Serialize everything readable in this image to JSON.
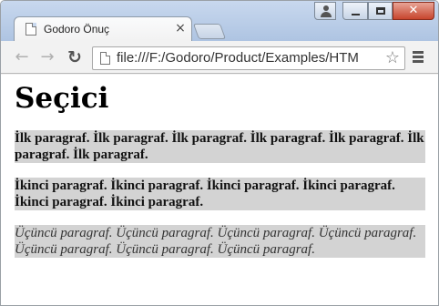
{
  "browser": {
    "tab": {
      "title": "Godoro Önuç",
      "close_glyph": "×"
    },
    "address_bar": {
      "url": "file:///F:/Godoro/Product/Examples/HTM"
    },
    "nav": {
      "back_glyph": "←",
      "forward_glyph": "→",
      "reload_glyph": "↻"
    },
    "star_glyph": "☆",
    "close_glyph": "✕",
    "icons": [
      "page-icon",
      "user-icon",
      "minimize-icon",
      "maximize-icon",
      "close-icon",
      "back-icon",
      "forward-icon",
      "reload-icon",
      "star-icon",
      "menu-icon"
    ]
  },
  "page": {
    "heading": "Seçici",
    "paragraphs": [
      {
        "text": "İlk paragraf. İlk paragraf. İlk paragraf. İlk paragraf. İlk paragraf. İlk paragraf. İlk paragraf.",
        "style": "bold"
      },
      {
        "text": "İkinci paragraf. İkinci paragraf. İkinci paragraf. İkinci paragraf. İkinci paragraf. İkinci paragraf.",
        "style": "bold"
      },
      {
        "text": "Üçüncü paragraf. Üçüncü paragraf. Üçüncü paragraf. Üçüncü paragraf. Üçüncü paragraf. Üçüncü paragraf. Üçüncü paragraf.",
        "style": "italic"
      }
    ]
  },
  "colors": {
    "titlebar": "#aec4e2",
    "paragraph_background": "#d3d3d3",
    "close_button": "#c7452d"
  }
}
